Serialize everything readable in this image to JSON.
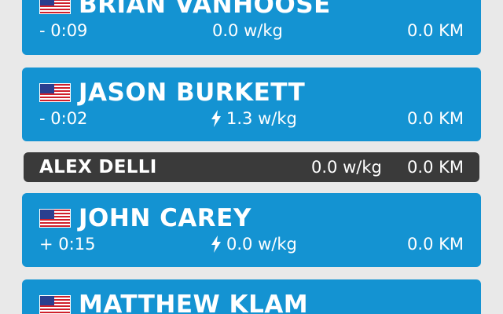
{
  "riders": [
    {
      "name": "BRIAN VANHOOSE",
      "gap": "- 0:09",
      "power": "0.0 w/kg",
      "distance": "0.0 KM",
      "boost_icon": false,
      "flag": "us-flag-icon"
    },
    {
      "name": "JASON BURKETT",
      "gap": "- 0:02",
      "power": "1.3 w/kg",
      "distance": "0.0 KM",
      "boost_icon": true,
      "flag": "us-flag-icon"
    },
    {
      "name": "JOHN CAREY",
      "gap": "+ 0:15",
      "power": "0.0 w/kg",
      "distance": "0.0 KM",
      "boost_icon": true,
      "flag": "us-flag-icon"
    },
    {
      "name": "MATTHEW KLAM",
      "flag": "us-flag-icon"
    }
  ],
  "current_rider": {
    "name": "ALEX DELLI",
    "power": "0.0 w/kg",
    "distance": "0.0 KM"
  },
  "colors": {
    "card_blue": "#1493d2",
    "current_rider_bg": "#3a3a3a",
    "background": "#e9e9e9",
    "text": "#ffffff"
  }
}
